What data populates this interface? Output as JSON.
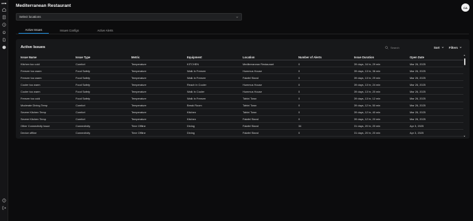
{
  "app": {
    "logo_text": "ARM"
  },
  "rail": {
    "top_icons": [
      "home-icon",
      "building-icon",
      "clock-icon",
      "bell-icon",
      "document-icon",
      "alert-icon"
    ],
    "bottom_icons": [
      "help-icon",
      "logout-icon"
    ]
  },
  "header": {
    "title": "Mediterranean Restaurant",
    "avatar_initials": "CA"
  },
  "location_select": {
    "value": "Select locations"
  },
  "tabs": [
    {
      "label": "Active Issues",
      "active": true
    },
    {
      "label": "Issues Configs",
      "active": false
    },
    {
      "label": "Active Alerts",
      "active": false
    }
  ],
  "panel": {
    "title": "Active Issues",
    "search_placeholder": "Search",
    "sort_label": "Sort",
    "filters_label": "Filters"
  },
  "table": {
    "columns": [
      "Issue Name",
      "Issue Type",
      "Metric",
      "Equipment",
      "Location",
      "Number of Alerts",
      "Issue Duration",
      "Open Date"
    ],
    "rows": [
      [
        "Kitchen too cold",
        "Comfort",
        "Temperature",
        "KITCHEN",
        "Mediterranean Restaurant",
        "0",
        "39 days, 16 hr, 29 min",
        "Mar 26, 2025"
      ],
      [
        "Freezer too warm",
        "Food Safety",
        "Temperature",
        "Walk In Freezer",
        "Hummus House",
        "0",
        "39 days, 13 hr, 36 min",
        "Mar 26, 2025"
      ],
      [
        "Freezer too warm",
        "Food Safety",
        "Temperature",
        "Walk In Freezer",
        "Falafel Stand",
        "0",
        "39 days, 13 hr, 29 min",
        "Mar 26, 2025"
      ],
      [
        "Cooler too warm",
        "Food Safety",
        "Temperature",
        "Reach In Cooler",
        "Hummus House",
        "0",
        "39 days, 13 hr, 24 min",
        "Mar 26, 2025"
      ],
      [
        "Cooler too warm",
        "Food Safety",
        "Temperature",
        "Walk In Cooler",
        "Hummus House",
        "0",
        "39 days, 13 hr, 20 min",
        "Mar 26, 2025"
      ],
      [
        "Freezer too cold",
        "Food Safety",
        "Temperature",
        "Walk In Freezer",
        "Tahini Town",
        "0",
        "39 days, 13 hr, 12 min",
        "Mar 26, 2025"
      ],
      [
        "Moderate Dining Temp",
        "Comfort",
        "Temperature",
        "Break Room",
        "Tahini Town",
        "0",
        "39 days, 12 hr, 50 min",
        "Mar 26, 2025"
      ],
      [
        "Severe Kitchen Temp",
        "Comfort",
        "Temperature",
        "Kitchen",
        "Tahini Town",
        "0",
        "39 days, 12 hr, 40 min",
        "Mar 26, 2025"
      ],
      [
        "Severe Kitchen Temp",
        "Comfort",
        "Temperature",
        "Kitchen",
        "Falafel Stand",
        "0",
        "39 days, 12 hr, 20 min",
        "Mar 26, 2025"
      ],
      [
        "Other Connectivity Issue",
        "Connectivity",
        "Time Offline",
        "Dining",
        "Falafel Stand",
        "34",
        "31 days, 20 hr, 20 min",
        "Apr 3, 2025"
      ],
      [
        "Device offline",
        "Connectivity",
        "Time Offline",
        "Dining",
        "Falafel Stand",
        "0",
        "31 days, 20 hr, 20 min",
        "Apr 3, 2025"
      ]
    ]
  },
  "colors": {
    "accent": "#1e8fe0",
    "background": "#0c0c0d",
    "panel": "#17181a"
  }
}
